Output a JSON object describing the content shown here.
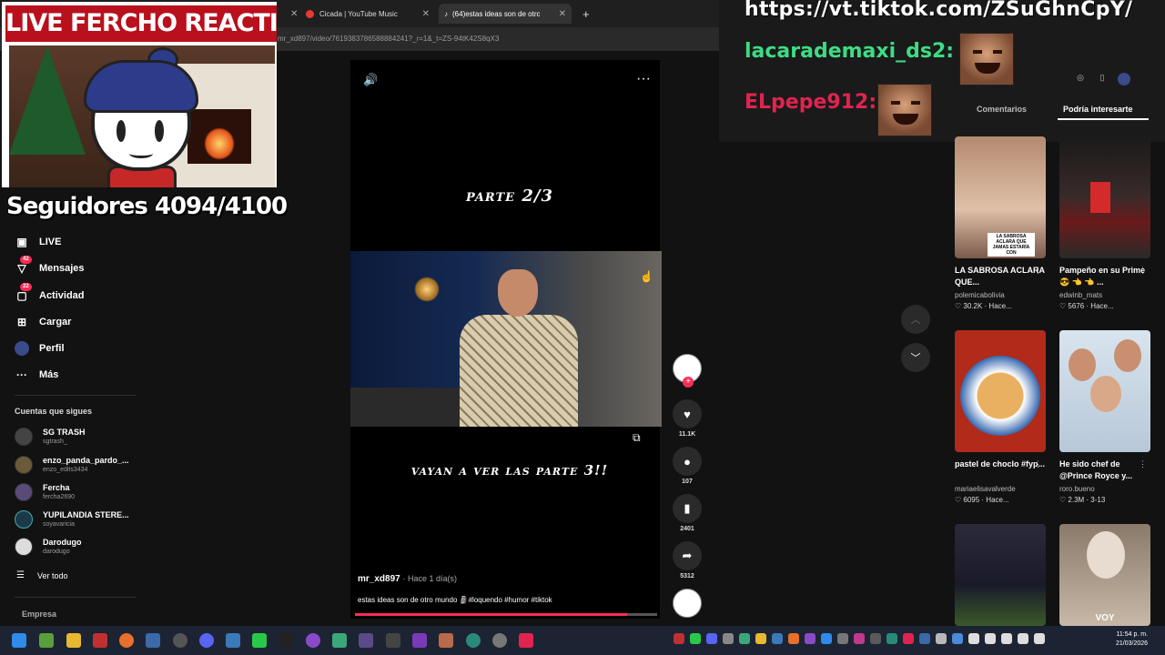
{
  "browser": {
    "tabs": [
      {
        "label": "Cicada | YouTube Music"
      },
      {
        "label": "(64)estas ideas son de otro"
      }
    ],
    "url": "mr_xd897/video/7619383786588884241?_r=1&_t=ZS-94tK42S8qX3"
  },
  "stream": {
    "title": "LIVE FERCHO REACTION",
    "followers": "Seguidores 4094/4100",
    "chat_url": "https://vt.tiktok.com/ZSuGhnCpY/",
    "chat": [
      {
        "user": "lacarademaxi_ds2",
        "color": "#3ddc84"
      },
      {
        "user": "ELpepe912",
        "color": "#e0244f"
      }
    ]
  },
  "sidebar": {
    "items": [
      {
        "label": "LIVE",
        "icon": "live-icon"
      },
      {
        "label": "Mensajes",
        "icon": "message-icon",
        "badge": "42"
      },
      {
        "label": "Actividad",
        "icon": "activity-icon",
        "badge": "22"
      },
      {
        "label": "Cargar",
        "icon": "upload-icon"
      },
      {
        "label": "Perfil",
        "icon": "profile-icon"
      },
      {
        "label": "Más",
        "icon": "more-icon"
      }
    ],
    "following_title": "Cuentas que sigues",
    "accounts": [
      {
        "name": "SG TRASH",
        "handle": "sgtrash_"
      },
      {
        "name": "enzo_panda_pardo_...",
        "handle": "enzo_edits3434"
      },
      {
        "name": "Fercha",
        "handle": "fercha2690"
      },
      {
        "name": "YUPILANDIA STERE...",
        "handle": "soyavaricia"
      },
      {
        "name": "Darodugo",
        "handle": "darodugo"
      }
    ],
    "see_all": "Ver todo",
    "company": "Empresa"
  },
  "video": {
    "overlay_top": "parte 2/3",
    "overlay_bottom": "vayan a ver las parte 3!!",
    "author": "mr_xd897",
    "time": "· Hace 1 día(s)",
    "caption": "estas ideas son de otro mundo 🗿#loquendo #humor #tiktok",
    "progress": 0.9,
    "likes": "11.1K",
    "comments": "107",
    "saves": "2401",
    "shares": "5312"
  },
  "right_panel": {
    "tabs": [
      "Comentarios",
      "Podría interesarte"
    ],
    "cards": [
      {
        "title": "LA SABROSA ACLARA QUE...",
        "user": "polemicabolivia",
        "stats": "♡ 30.2K · Hace...",
        "overlay": "LA SABROSA ACLARA QUE JAMAS ESTARÍA CON"
      },
      {
        "title": "Pampeño en su Prime 😎 👈 👈 ...",
        "user": "edwinb_mats",
        "stats": "♡ 5676 · Hace..."
      },
      {
        "title": "pastel de choclo #fyp...",
        "user": "mariaelisavalverde",
        "stats": "♡ 6095 · Hace..."
      },
      {
        "title": "He sido chef de @Prince Royce y...",
        "user": "roro.bueno",
        "stats": "♡ 2.3M · 3-13"
      },
      {
        "title": "",
        "user": "",
        "stats": ""
      },
      {
        "title": "",
        "user": "",
        "stats": "",
        "overlay": "VOY"
      }
    ]
  },
  "taskbar": {
    "time": "11:54 p. m.",
    "date": "21/03/2026"
  }
}
